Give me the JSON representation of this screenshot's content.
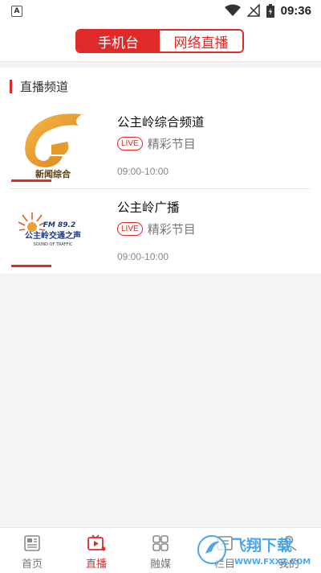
{
  "status_bar": {
    "time": "09:36",
    "indicator": "A"
  },
  "header": {
    "tabs": [
      {
        "label": "手机台",
        "active": true
      },
      {
        "label": "网络直播",
        "active": false
      }
    ]
  },
  "section": {
    "title": "直播频道"
  },
  "channels": [
    {
      "name": "公主岭综合频道",
      "badge": "LIVE",
      "program": "精彩节目",
      "time": "09:00-10:00",
      "logo_text": "新闻综合"
    },
    {
      "name": "公主岭广播",
      "badge": "LIVE",
      "program": "精彩节目",
      "time": "09:00-10:00",
      "logo_freq": "FM 89.2",
      "logo_text": "公主岭交通之声",
      "logo_sub": "SOUND OF TRAFFIC"
    }
  ],
  "tabbar": {
    "items": [
      {
        "label": "首页",
        "icon": "news-icon",
        "active": false
      },
      {
        "label": "直播",
        "icon": "live-play-icon",
        "active": true
      },
      {
        "label": "融媒",
        "icon": "grid-icon",
        "active": false
      },
      {
        "label": "栏目",
        "icon": "column-icon",
        "active": false
      },
      {
        "label": "我的",
        "icon": "profile-icon",
        "active": false
      }
    ]
  },
  "watermark": {
    "brand": "飞翔下载",
    "url": "WWW.FXXZ.COM"
  },
  "colors": {
    "accent": "#e02a2a",
    "background": "#f4f4f4"
  }
}
